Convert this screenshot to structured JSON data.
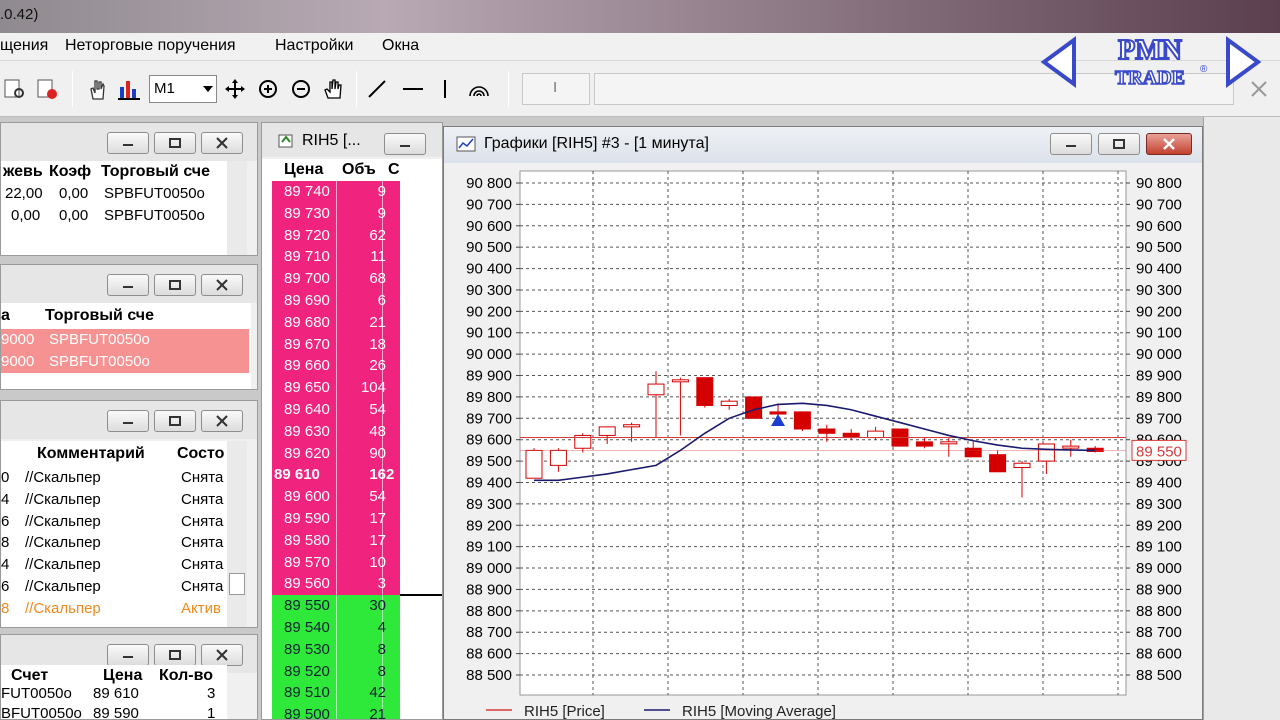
{
  "app": {
    "title_fragment": ".0.42)"
  },
  "menu": [
    {
      "label": "щения",
      "x": 0
    },
    {
      "label": "Неторговые поручения",
      "x": 65
    },
    {
      "label": "Настройки",
      "x": 275
    },
    {
      "label": "Окна",
      "x": 382
    }
  ],
  "toolbar": {
    "timeframe": "M1",
    "field_text": "I"
  },
  "logo": {
    "line1": "PMN",
    "line2": "TRADE",
    "mark": "®"
  },
  "positions_panel": {
    "headers": [
      "жевь",
      "Коэф",
      "Торговый сче"
    ],
    "rows": [
      [
        "22,00",
        "0,00",
        "SPBFUT0050o"
      ],
      [
        "0,00",
        "0,00",
        "SPBFUT0050o"
      ]
    ]
  },
  "limits_panel": {
    "headers": [
      "а",
      "Торговый сче"
    ],
    "rows": [
      [
        "9000",
        "SPBFUT0050o"
      ],
      [
        "9000",
        "SPBFUT0050o"
      ]
    ]
  },
  "orders_panel": {
    "headers": [
      "",
      "Комментарий",
      "Состо"
    ],
    "rows": [
      [
        "0",
        "//Скальпер",
        "Снята"
      ],
      [
        "4",
        "//Скальпер",
        "Снята"
      ],
      [
        "6",
        "//Скальпер",
        "Снята"
      ],
      [
        "8",
        "//Скальпер",
        "Снята"
      ],
      [
        "4",
        "//Скальпер",
        "Снята"
      ],
      [
        "6",
        "//Скальпер",
        "Снята"
      ],
      [
        "8",
        "//Скальпер",
        "Актив"
      ]
    ]
  },
  "trades_panel": {
    "headers": [
      "Счет",
      "Цена",
      "Кол-во"
    ],
    "rows": [
      [
        "FUT0050o",
        "89 610",
        "3"
      ],
      [
        "BFUT0050o",
        "89 590",
        "1"
      ]
    ]
  },
  "order_book": {
    "title": "RIH5 [...",
    "headers": [
      "Цена",
      "Объ",
      "С"
    ],
    "asks": [
      [
        "89 740",
        "9"
      ],
      [
        "89 730",
        "9"
      ],
      [
        "89 720",
        "62"
      ],
      [
        "89 710",
        "11"
      ],
      [
        "89 700",
        "68"
      ],
      [
        "89 690",
        "6"
      ],
      [
        "89 680",
        "21"
      ],
      [
        "89 670",
        "18"
      ],
      [
        "89 660",
        "26"
      ],
      [
        "89 650",
        "104"
      ],
      [
        "89 640",
        "54"
      ],
      [
        "89 630",
        "48"
      ],
      [
        "89 620",
        "90"
      ]
    ],
    "current": {
      "price": "89 610",
      "volume": "16",
      "own": "2"
    },
    "asks_low": [
      [
        "89 600",
        "54"
      ],
      [
        "89 590",
        "17"
      ],
      [
        "89 580",
        "17"
      ],
      [
        "89 570",
        "10"
      ],
      [
        "89 560",
        "3"
      ]
    ],
    "bids": [
      [
        "89 550",
        "30"
      ],
      [
        "89 540",
        "4"
      ],
      [
        "89 530",
        "8"
      ],
      [
        "89 520",
        "8"
      ],
      [
        "89 510",
        "42"
      ],
      [
        "89 500",
        "21"
      ]
    ]
  },
  "chart_window": {
    "title": "Графики [RIH5] #3 - [1 минута]"
  },
  "colors": {
    "ask": "#f0237f",
    "bid": "#2ee83a",
    "candle_down": "#d40000",
    "ma": "#1a1a6e",
    "price_line": "#d63a3a"
  },
  "chart_data": {
    "type": "candlestick",
    "y_range": [
      88500,
      90800
    ],
    "y_ticks": [
      "90 800",
      "90 700",
      "90 600",
      "90 500",
      "90 400",
      "90 300",
      "90 200",
      "90 100",
      "90 000",
      "89 900",
      "89 800",
      "89 700",
      "89 600",
      "89 500",
      "89 400",
      "89 300",
      "89 200",
      "89 100",
      "89 000",
      "88 900",
      "88 800",
      "88 700",
      "88 600",
      "88 500"
    ],
    "last_price_label": "89 550",
    "last_price": 89550,
    "price_level": 89610,
    "legend": [
      "RIH5 [Price]",
      "RIH5 [Moving Average]"
    ],
    "candles": [
      {
        "o": 89420,
        "h": 89560,
        "l": 89420,
        "c": 89550
      },
      {
        "o": 89480,
        "h": 89560,
        "l": 89450,
        "c": 89550
      },
      {
        "o": 89560,
        "h": 89630,
        "l": 89540,
        "c": 89620
      },
      {
        "o": 89620,
        "h": 89660,
        "l": 89580,
        "c": 89660
      },
      {
        "o": 89660,
        "h": 89680,
        "l": 89590,
        "c": 89670
      },
      {
        "o": 89810,
        "h": 89920,
        "l": 89610,
        "c": 89860
      },
      {
        "o": 89880,
        "h": 89890,
        "l": 89620,
        "c": 89880
      },
      {
        "o": 89890,
        "h": 89890,
        "l": 89750,
        "c": 89760
      },
      {
        "o": 89760,
        "h": 89790,
        "l": 89740,
        "c": 89780
      },
      {
        "o": 89800,
        "h": 89800,
        "l": 89700,
        "c": 89700
      },
      {
        "o": 89730,
        "h": 89770,
        "l": 89700,
        "c": 89720
      },
      {
        "o": 89730,
        "h": 89730,
        "l": 89640,
        "c": 89650
      },
      {
        "o": 89650,
        "h": 89670,
        "l": 89590,
        "c": 89630
      },
      {
        "o": 89630,
        "h": 89650,
        "l": 89600,
        "c": 89610
      },
      {
        "o": 89610,
        "h": 89660,
        "l": 89600,
        "c": 89640
      },
      {
        "o": 89650,
        "h": 89650,
        "l": 89570,
        "c": 89570
      },
      {
        "o": 89590,
        "h": 89610,
        "l": 89560,
        "c": 89570
      },
      {
        "o": 89590,
        "h": 89610,
        "l": 89520,
        "c": 89590
      },
      {
        "o": 89560,
        "h": 89590,
        "l": 89520,
        "c": 89520
      },
      {
        "o": 89530,
        "h": 89550,
        "l": 89450,
        "c": 89450
      },
      {
        "o": 89470,
        "h": 89500,
        "l": 89330,
        "c": 89490
      },
      {
        "o": 89500,
        "h": 89560,
        "l": 89440,
        "c": 89580
      },
      {
        "o": 89570,
        "h": 89600,
        "l": 89520,
        "c": 89570
      },
      {
        "o": 89560,
        "h": 89570,
        "l": 89540,
        "c": 89545
      }
    ],
    "moving_average": [
      89410,
      89410,
      89425,
      89440,
      89460,
      89480,
      89550,
      89630,
      89700,
      89740,
      89765,
      89770,
      89760,
      89740,
      89710,
      89680,
      89650,
      89620,
      89595,
      89575,
      89560,
      89555,
      89552,
      89550
    ],
    "signal_marker_candle": 10
  }
}
